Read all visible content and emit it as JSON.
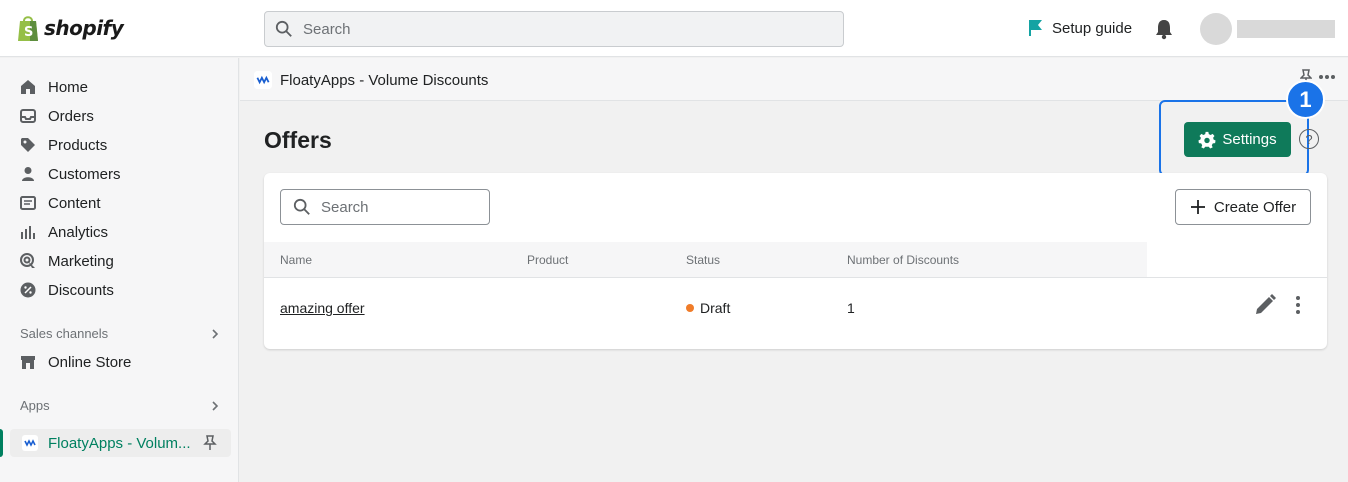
{
  "topbar": {
    "logo_text": "shopify",
    "search_placeholder": "Search",
    "setup_guide": "Setup guide"
  },
  "sidebar": {
    "items": [
      {
        "label": "Home",
        "icon": "home-icon"
      },
      {
        "label": "Orders",
        "icon": "orders-icon"
      },
      {
        "label": "Products",
        "icon": "tag-icon"
      },
      {
        "label": "Customers",
        "icon": "person-icon"
      },
      {
        "label": "Content",
        "icon": "content-icon"
      },
      {
        "label": "Analytics",
        "icon": "bar-chart-icon"
      },
      {
        "label": "Marketing",
        "icon": "target-icon"
      },
      {
        "label": "Discounts",
        "icon": "discount-icon"
      }
    ],
    "sales_channels_label": "Sales channels",
    "online_store": "Online Store",
    "apps_label": "Apps",
    "active_app": "FloatyApps - Volum..."
  },
  "app_header": {
    "title": "FloatyApps - Volume Discounts"
  },
  "main": {
    "page_title": "Offers",
    "settings_label": "Settings",
    "help_symbol": "?",
    "annotation_number": "1",
    "search_placeholder": "Search",
    "create_offer_label": "Create Offer",
    "columns": [
      "Name",
      "Product",
      "Status",
      "Number of Discounts"
    ],
    "rows": [
      {
        "name": "amazing offer",
        "product": "",
        "status": "Draft",
        "discounts": "1"
      }
    ]
  },
  "colors": {
    "primary_green": "#0f7a5a",
    "highlight_blue": "#1a73e8",
    "draft_orange": "#f07c29"
  }
}
